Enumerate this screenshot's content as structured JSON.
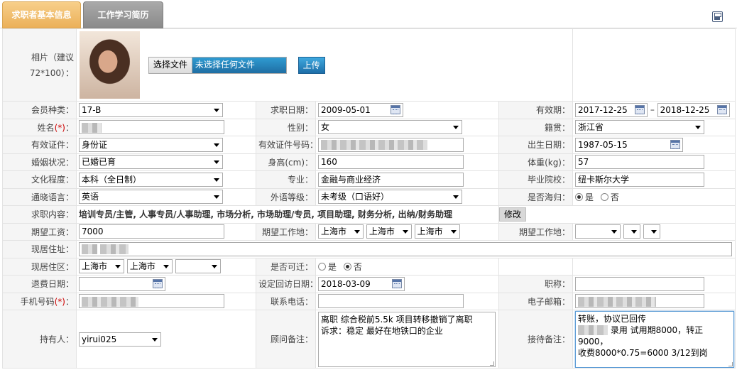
{
  "tabs": {
    "basic_info": "求职者基本信息",
    "work_history": "工作学习简历"
  },
  "photo": {
    "label": "相片（建议72*100）：",
    "choose_file": "选择文件",
    "no_file": "未选择任何文件",
    "upload": "上传"
  },
  "labels": {
    "member_type": "会员种类：",
    "apply_date": "求职日期：",
    "valid_period": "有效期：",
    "range_sep": "–",
    "name": "姓名",
    "required_mark": "(*)",
    "colon": "：",
    "gender": "性别：",
    "native_place": "籍贯：",
    "id_type": "有效证件：",
    "id_number": "有效证件号码：",
    "birth_date": "出生日期：",
    "marital": "婚姻状况：",
    "height": "身高(cm)：",
    "weight": "体重(kg)：",
    "education": "文化程度：",
    "major": "专业：",
    "school": "毕业院校：",
    "language": "通晓语言：",
    "language_level": "外语等级：",
    "returnee": "是否海归：",
    "job_content": "求职内容：",
    "expected_salary": "期望工资：",
    "expected_location": "期望工作地：",
    "current_address": "现居住址：",
    "current_area": "现居住区：",
    "relocate": "是否可迁：",
    "refund_date": "退费日期：",
    "followup_date": "设定回访日期：",
    "title": "职称：",
    "mobile": "手机号码",
    "phone": "联系电话：",
    "email": "电子邮箱：",
    "owner": "持有人：",
    "advisor_note": "顾问备注：",
    "reception_note": "接待备注："
  },
  "values": {
    "member_type": "17-B",
    "apply_date": "2009-05-01",
    "valid_from": "2017-12-25",
    "valid_to": "2018-12-25",
    "gender": "女",
    "native_place": "浙江省",
    "id_type": "身份证",
    "birth_date": "1987-05-15",
    "marital": "已婚已育",
    "height": "160",
    "weight": "57",
    "education": "本科（全日制）",
    "major": "金融与商业经济",
    "school": "纽卡斯尔大学",
    "language": "英语",
    "language_level": "未考级（口语好）",
    "yes": "是",
    "no": "否",
    "job_content": "培训专员/主管, 人事专员/人事助理, 市场分析, 市场助理/专员, 项目助理, 财务分析, 出纳/财务助理",
    "modify": "修改",
    "expected_salary": "7000",
    "loc1": "上海市",
    "loc2": "上海市",
    "loc3": "上海市",
    "area1": "上海市",
    "area2": "上海市",
    "followup_date": "2018-03-09",
    "owner": "yirui025",
    "advisor_note_1": "离职 综合税前5.5k 项目转移撤销了离职",
    "advisor_note_2": "诉求：稳定 最好在地铁口的企业",
    "reception_note_1": "转账，协议已回传",
    "reception_note_2": "录用  试用期8000，转正9000，",
    "reception_note_3": "收费8000*0.75=6000  3/12到岗"
  }
}
